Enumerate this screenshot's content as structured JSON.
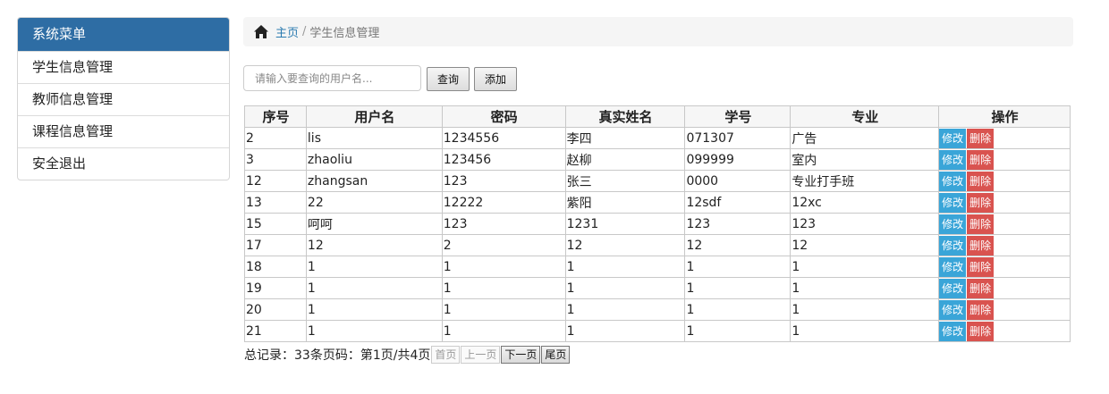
{
  "sidebar": {
    "header": "系统菜单",
    "items": [
      {
        "label": "学生信息管理"
      },
      {
        "label": "教师信息管理"
      },
      {
        "label": "课程信息管理"
      },
      {
        "label": "安全退出"
      }
    ]
  },
  "breadcrumb": {
    "home_icon": "home-icon",
    "home": "主页",
    "separator": "/",
    "current": "学生信息管理"
  },
  "search": {
    "placeholder": "请输入要查询的用户名...",
    "search_label": "查询",
    "add_label": "添加"
  },
  "table": {
    "headers": [
      "序号",
      "用户名",
      "密码",
      "真实姓名",
      "学号",
      "专业",
      "操作"
    ],
    "edit_label": "修改",
    "delete_label": "删除",
    "rows": [
      [
        "2",
        "lis",
        "1234556",
        "李四",
        "071307",
        "广告"
      ],
      [
        "3",
        "zhaoliu",
        "123456",
        "赵柳",
        "099999",
        "室内"
      ],
      [
        "12",
        "zhangsan",
        "123",
        "张三",
        "0000",
        "专业打手班"
      ],
      [
        "13",
        "22",
        "12222",
        "紫阳",
        "12sdf",
        "12xc"
      ],
      [
        "15",
        "呵呵",
        "123",
        "1231",
        "123",
        "123"
      ],
      [
        "17",
        "12",
        "2",
        "12",
        "12",
        "12"
      ],
      [
        "18",
        "1",
        "1",
        "1",
        "1",
        "1"
      ],
      [
        "19",
        "1",
        "1",
        "1",
        "1",
        "1"
      ],
      [
        "20",
        "1",
        "1",
        "1",
        "1",
        "1"
      ],
      [
        "21",
        "1",
        "1",
        "1",
        "1",
        "1"
      ]
    ]
  },
  "pager": {
    "summary": "总记录：33条页码：第1页/共4页",
    "first": "首页",
    "prev": "上一页",
    "next": "下一页",
    "last": "尾页"
  }
}
